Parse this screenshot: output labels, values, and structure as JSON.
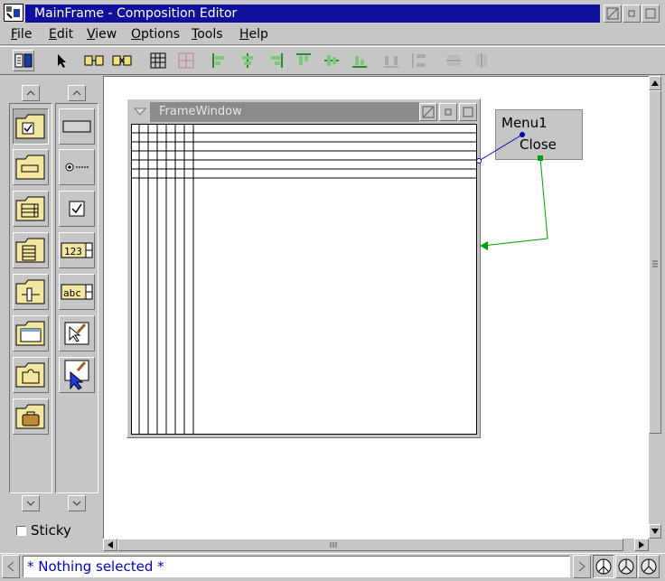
{
  "window": {
    "title": "MainFrame - Composition Editor"
  },
  "menubar": [
    {
      "label": "File",
      "mnemonic": "F",
      "rest": "ile"
    },
    {
      "label": "Edit",
      "mnemonic": "E",
      "rest": "dit"
    },
    {
      "label": "View",
      "mnemonic": "V",
      "rest": "iew"
    },
    {
      "label": "Options",
      "mnemonic": "O",
      "rest": "ptions"
    },
    {
      "label": "Tools",
      "mnemonic": "T",
      "rest": "ools"
    },
    {
      "label": "Help",
      "mnemonic": "H",
      "rest": "elp"
    }
  ],
  "toolbar": {
    "icons": [
      "bean-info-icon",
      "selection-arrow-icon",
      "link-parts-icon",
      "unlink-parts-icon",
      "grid-icon",
      "snap-grid-icon",
      "align-left-icon",
      "align-center-icon",
      "align-right-icon",
      "align-top-icon",
      "align-middle-icon",
      "align-bottom-icon",
      "distribute-horizontal-icon",
      "distribute-vertical-icon",
      "match-width-icon",
      "match-height-icon"
    ]
  },
  "palette": {
    "categories": [
      "buttons-folder-icon",
      "entry-folder-icon",
      "lists-folder-icon",
      "containers-folder-icon",
      "sliders-folder-icon",
      "frames-folder-icon",
      "parts-folder-icon",
      "models-folder-icon"
    ],
    "parts": [
      "push-button-icon",
      "radio-button-icon",
      "check-box-icon",
      "numeric-spin-icon",
      "text-spin-icon",
      "pointer-tool-icon",
      "sticky-pointer-icon"
    ],
    "sticky_label": "Sticky"
  },
  "canvas": {
    "frame_window": {
      "title": "FrameWindow"
    },
    "menu_part": {
      "name": "Menu1",
      "item": "Close"
    }
  },
  "status": {
    "text": "* Nothing selected *"
  },
  "colors": {
    "title_active": "#10109c",
    "status_text": "#0000c8",
    "connection_blue": "#0000b4",
    "connection_green": "#00a000"
  }
}
